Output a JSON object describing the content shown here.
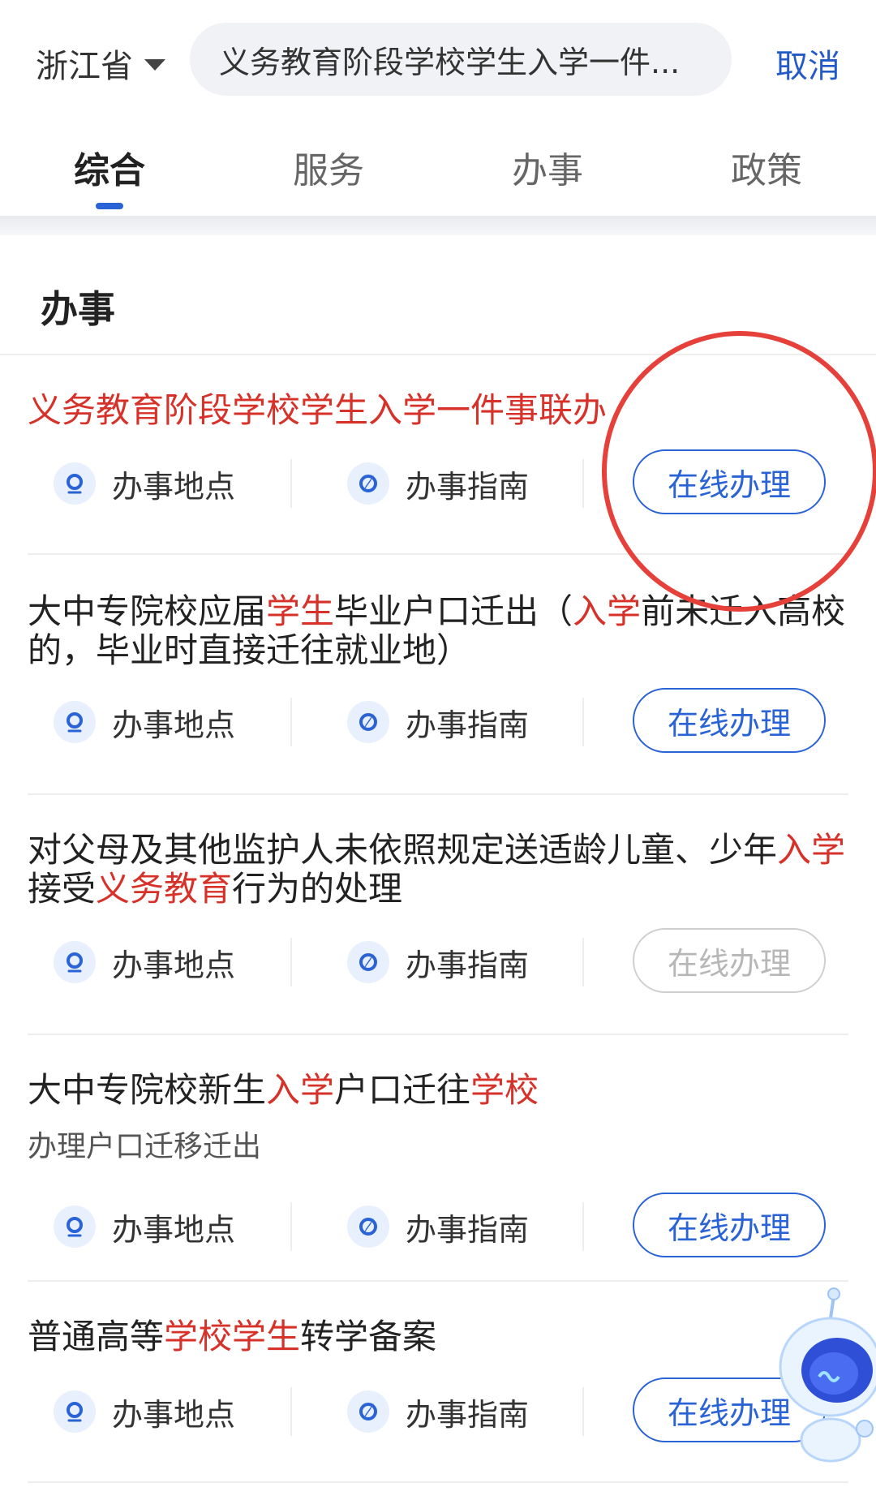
{
  "header": {
    "region": "浙江省",
    "search_text": "义务教育阶段学校学生入学一件...",
    "cancel": "取消"
  },
  "tabs": [
    {
      "label": "综合",
      "active": true
    },
    {
      "label": "服务",
      "active": false
    },
    {
      "label": "办事",
      "active": false
    },
    {
      "label": "政策",
      "active": false
    }
  ],
  "section": {
    "title": "办事"
  },
  "items": [
    {
      "title_parts": [
        {
          "text": "义务教育阶段学校学生入学一件事联办",
          "hl": true
        }
      ],
      "subtitle": "",
      "location_label": "办事地点",
      "guide_label": "办事指南",
      "online_label": "在线办理",
      "online_enabled": true
    },
    {
      "title_parts": [
        {
          "text": "大中专院校应届",
          "hl": false
        },
        {
          "text": "学生",
          "hl": true
        },
        {
          "text": "毕业户口迁出（",
          "hl": false
        },
        {
          "text": "入学",
          "hl": true
        },
        {
          "text": "前未迁入高校的，毕业时直接迁往就业地）",
          "hl": false
        }
      ],
      "subtitle": "",
      "location_label": "办事地点",
      "guide_label": "办事指南",
      "online_label": "在线办理",
      "online_enabled": true
    },
    {
      "title_parts": [
        {
          "text": "对父母及其他监护人未依照规定送适龄儿童、少年",
          "hl": false
        },
        {
          "text": "入学",
          "hl": true
        },
        {
          "text": "接受",
          "hl": false
        },
        {
          "text": "义务教育",
          "hl": true
        },
        {
          "text": "行为的处理",
          "hl": false
        }
      ],
      "subtitle": "",
      "location_label": "办事地点",
      "guide_label": "办事指南",
      "online_label": "在线办理",
      "online_enabled": false
    },
    {
      "title_parts": [
        {
          "text": "大中专院校新生",
          "hl": false
        },
        {
          "text": "入学",
          "hl": true
        },
        {
          "text": "户口迁往",
          "hl": false
        },
        {
          "text": "学校",
          "hl": true
        }
      ],
      "subtitle": "办理户口迁移迁出",
      "location_label": "办事地点",
      "guide_label": "办事指南",
      "online_label": "在线办理",
      "online_enabled": true
    },
    {
      "title_parts": [
        {
          "text": "普通高等",
          "hl": false
        },
        {
          "text": "学校学生",
          "hl": true
        },
        {
          "text": "转学备案",
          "hl": false
        }
      ],
      "subtitle": "",
      "location_label": "办事地点",
      "guide_label": "办事指南",
      "online_label": "在线办理",
      "online_enabled": true
    }
  ],
  "colors": {
    "highlight": "#d7322a",
    "accent": "#2a63d6",
    "annotation": "#e5413a",
    "disabled": "#b7b7b7"
  },
  "icons": {
    "location": "location-pin-icon",
    "guide": "compass-icon",
    "region_caret": "caret-down-icon"
  }
}
